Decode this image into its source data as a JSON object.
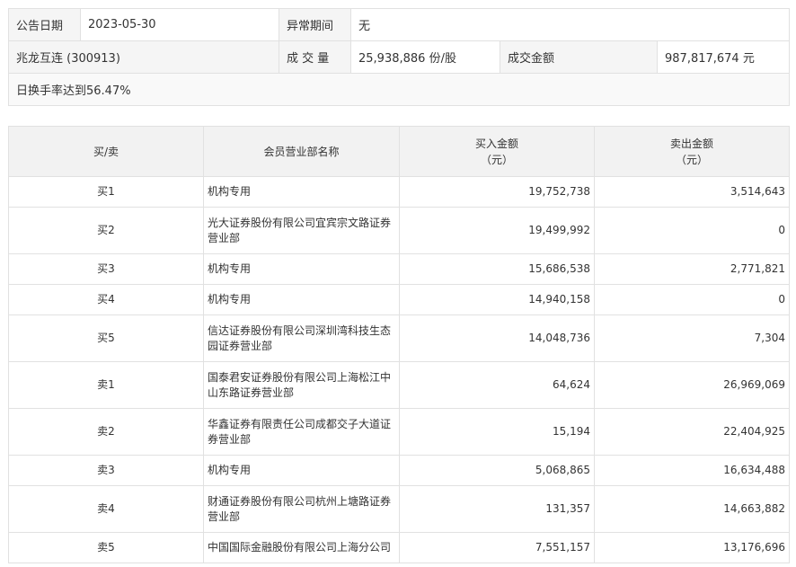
{
  "info": {
    "date_label": "公告日期",
    "date_value": "2023-05-30",
    "period_label": "异常期间",
    "period_value": "无",
    "stock_name": "兆龙互连 (300913)",
    "volume_label": "成 交 量",
    "volume_value": "25,938,886 份/股",
    "amount_label": "成交金额",
    "amount_value": "987,817,674 元",
    "reason": "日换手率达到56.47%"
  },
  "trades": {
    "headers": {
      "side": "买/卖",
      "name": "会员营业部名称",
      "buy_line1": "买入金额",
      "buy_line2": "（元）",
      "sell_line1": "卖出金额",
      "sell_line2": "（元）"
    },
    "rows": [
      {
        "side": "买1",
        "name": "机构专用",
        "buy": "19,752,738",
        "sell": "3,514,643"
      },
      {
        "side": "买2",
        "name": "光大证券股份有限公司宜宾宗文路证券营业部",
        "buy": "19,499,992",
        "sell": "0"
      },
      {
        "side": "买3",
        "name": "机构专用",
        "buy": "15,686,538",
        "sell": "2,771,821"
      },
      {
        "side": "买4",
        "name": "机构专用",
        "buy": "14,940,158",
        "sell": "0"
      },
      {
        "side": "买5",
        "name": "信达证券股份有限公司深圳湾科技生态园证券营业部",
        "buy": "14,048,736",
        "sell": "7,304"
      },
      {
        "side": "卖1",
        "name": "国泰君安证券股份有限公司上海松江中山东路证券营业部",
        "buy": "64,624",
        "sell": "26,969,069"
      },
      {
        "side": "卖2",
        "name": "华鑫证券有限责任公司成都交子大道证券营业部",
        "buy": "15,194",
        "sell": "22,404,925"
      },
      {
        "side": "卖3",
        "name": "机构专用",
        "buy": "5,068,865",
        "sell": "16,634,488"
      },
      {
        "side": "卖4",
        "name": "财通证券股份有限公司杭州上塘路证券营业部",
        "buy": "131,357",
        "sell": "14,663,882"
      },
      {
        "side": "卖5",
        "name": "中国国际金融股份有限公司上海分公司",
        "buy": "7,551,157",
        "sell": "13,176,696"
      }
    ]
  }
}
